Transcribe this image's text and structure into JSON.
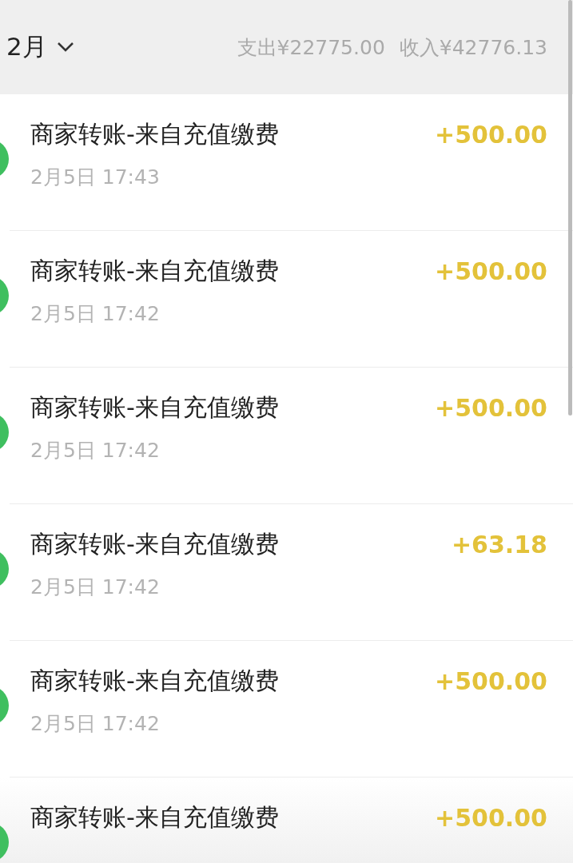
{
  "header": {
    "month": "2月",
    "expense": "支出¥22775.00",
    "income": "收入¥42776.13"
  },
  "transactions": [
    {
      "title": "商家转账-来自充值缴费",
      "time": "2月5日 17:43",
      "amount": "+500.00"
    },
    {
      "title": "商家转账-来自充值缴费",
      "time": "2月5日 17:42",
      "amount": "+500.00"
    },
    {
      "title": "商家转账-来自充值缴费",
      "time": "2月5日 17:42",
      "amount": "+500.00"
    },
    {
      "title": "商家转账-来自充值缴费",
      "time": "2月5日 17:42",
      "amount": "+63.18"
    },
    {
      "title": "商家转账-来自充值缴费",
      "time": "2月5日 17:42",
      "amount": "+500.00"
    },
    {
      "title": "商家转账-来自充值缴费",
      "amount": "+500.00"
    }
  ]
}
